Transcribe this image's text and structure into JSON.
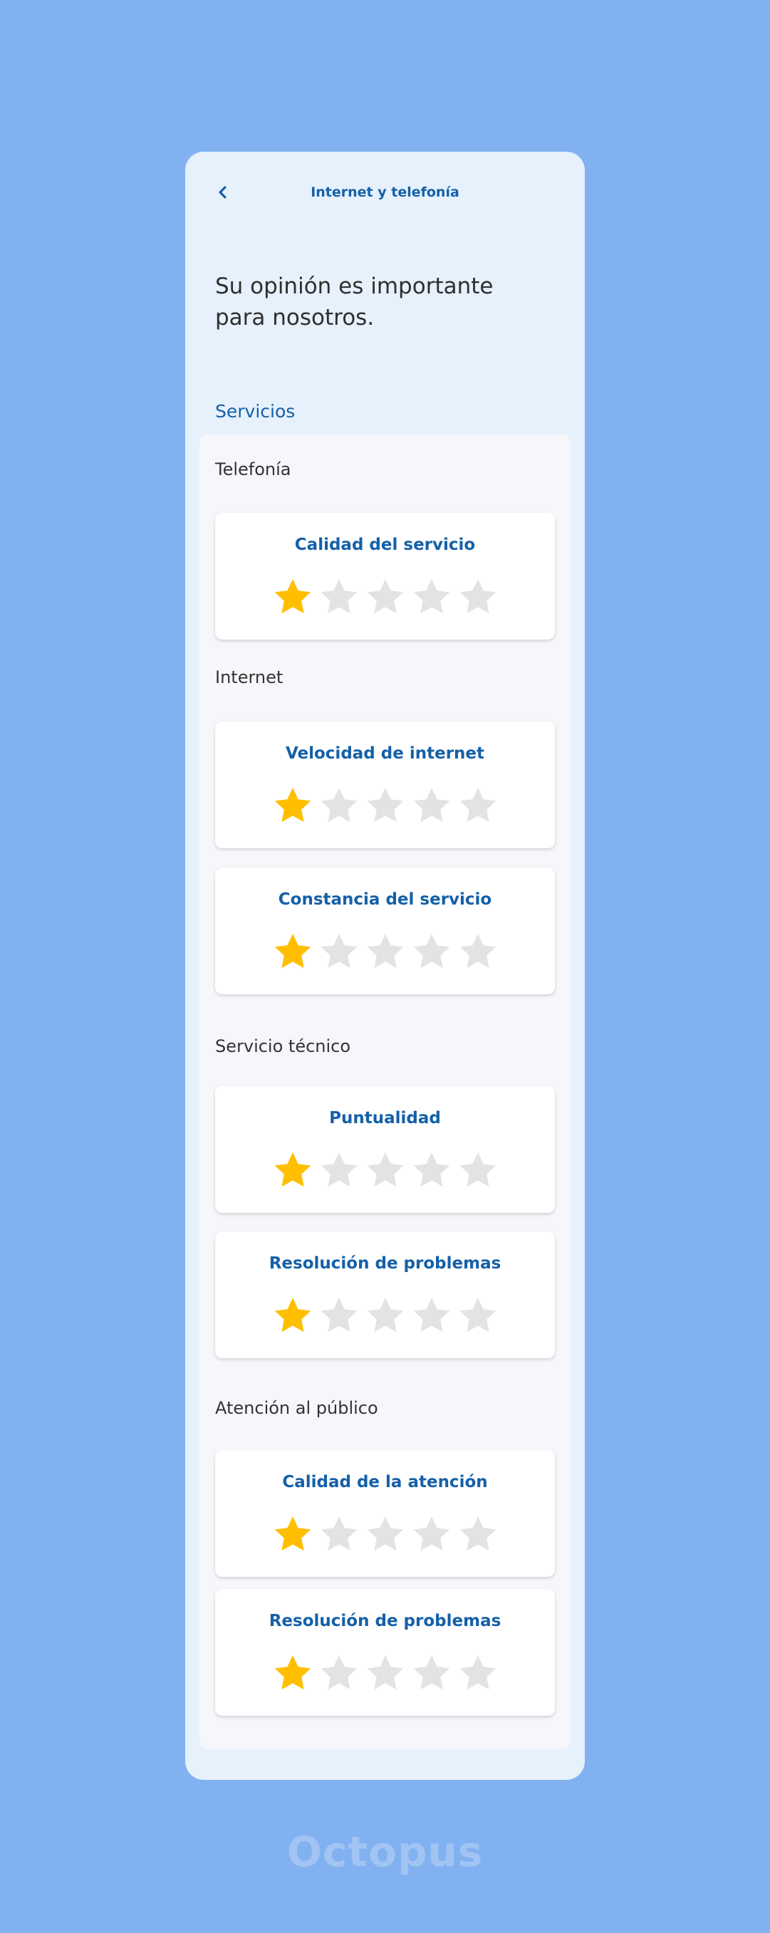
{
  "header": {
    "back_icon": "chevron-left-icon",
    "title": "Internet y telefonía"
  },
  "headline": "Su opinión es importante para nosotros.",
  "section_label": "Servicios",
  "max_rating": 5,
  "colors": {
    "background": "#82b1f2",
    "primary": "#1560a8",
    "star_active": "#ffbf00",
    "star_inactive": "#e3e3e3"
  },
  "groups": [
    {
      "title": "Telefonía",
      "items": [
        {
          "label": "Calidad del servicio",
          "rating": 1
        }
      ]
    },
    {
      "title": "Internet",
      "items": [
        {
          "label": "Velocidad de internet",
          "rating": 1
        },
        {
          "label": "Constancia del servicio",
          "rating": 1
        }
      ]
    },
    {
      "title": "Servicio técnico",
      "items": [
        {
          "label": "Puntualidad",
          "rating": 1
        },
        {
          "label": "Resolución de problemas",
          "rating": 1
        }
      ]
    },
    {
      "title": "Atención al público",
      "items": [
        {
          "label": "Calidad de la atención",
          "rating": 1
        },
        {
          "label": "Resolución de problemas",
          "rating": 1
        }
      ]
    }
  ],
  "watermark": "Octopus"
}
